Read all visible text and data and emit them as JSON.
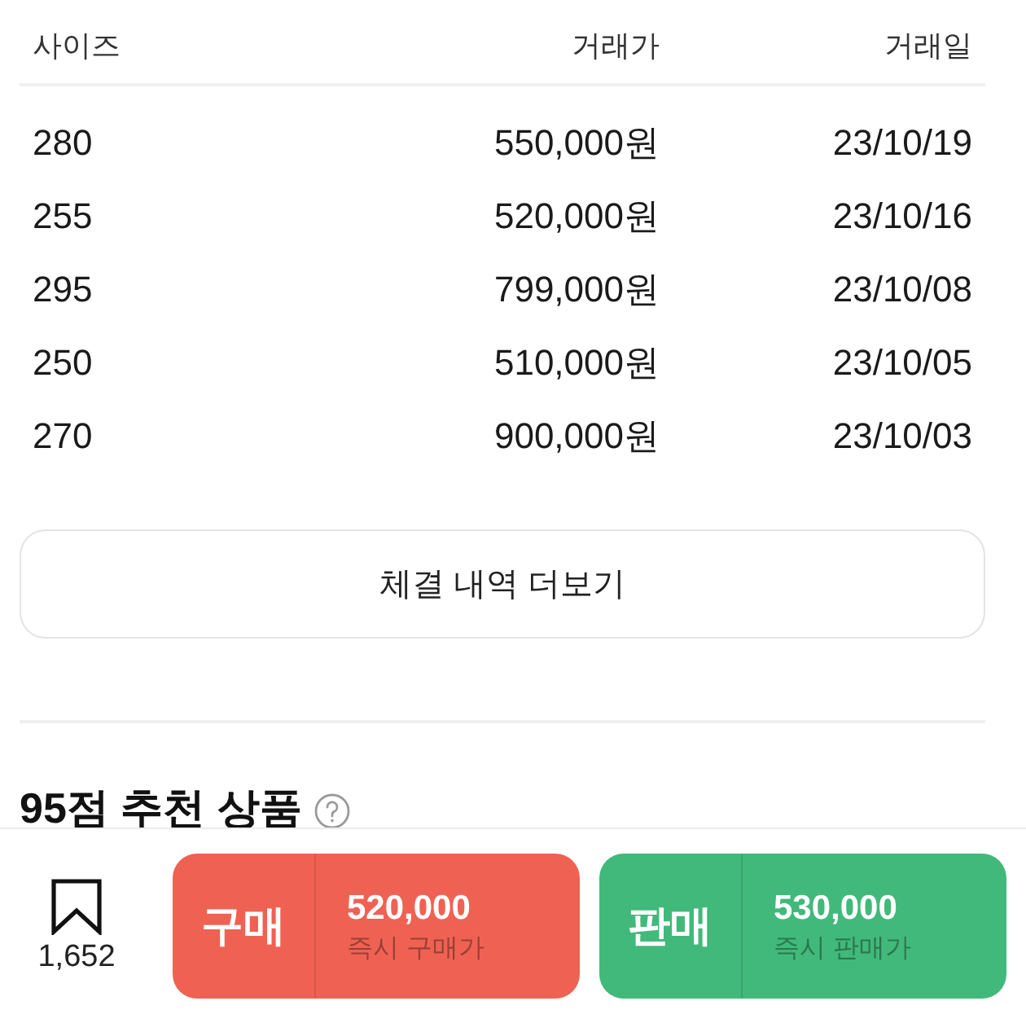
{
  "table": {
    "columns": [
      {
        "label": "사이즈"
      },
      {
        "label": "거래가"
      },
      {
        "label": "거래일"
      }
    ],
    "rows": [
      [
        "280",
        "550,000원",
        "23/10/19"
      ],
      [
        "255",
        "520,000원",
        "23/10/16"
      ],
      [
        "295",
        "799,000원",
        "23/10/08"
      ],
      [
        "250",
        "510,000원",
        "23/10/05"
      ],
      [
        "270",
        "900,000원",
        "23/10/03"
      ]
    ]
  },
  "more_button": {
    "label": "체결 내역 더보기"
  },
  "recommend_section": {
    "title": "95점 추천 상품"
  },
  "bottom_bar": {
    "bookmark_count": "1,652",
    "actions": [
      {
        "label": "구매",
        "price": "520,000",
        "caption": "즉시 구매가",
        "color": "#ef6253"
      },
      {
        "label": "판매",
        "price": "530,000",
        "caption": "즉시 판매가",
        "color": "#41b97a"
      }
    ]
  }
}
